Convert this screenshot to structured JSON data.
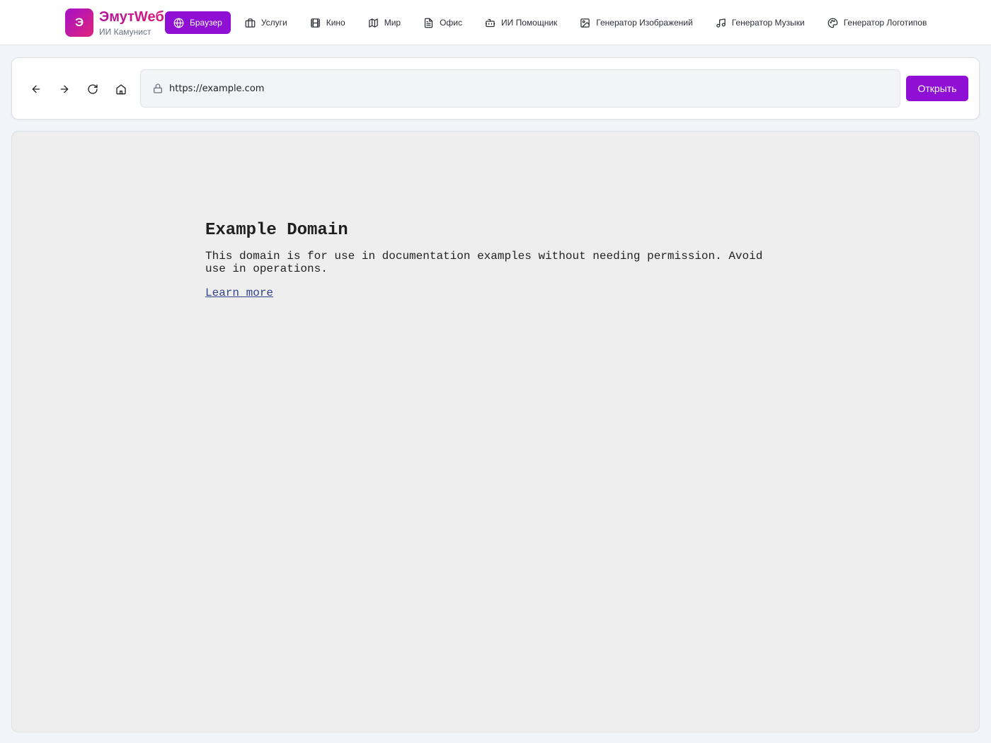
{
  "app": {
    "logo_letter": "Э",
    "name": "ЭмутWeб",
    "subtitle": "ИИ Камунист"
  },
  "nav": {
    "items": [
      {
        "label": "Браузер",
        "icon": "globe-icon",
        "active": true
      },
      {
        "label": "Услуги",
        "icon": "briefcase-icon",
        "active": false
      },
      {
        "label": "Кино",
        "icon": "film-icon",
        "active": false
      },
      {
        "label": "Мир",
        "icon": "map-icon",
        "active": false
      },
      {
        "label": "Офис",
        "icon": "document-icon",
        "active": false
      },
      {
        "label": "ИИ Помощник",
        "icon": "robot-icon",
        "active": false
      },
      {
        "label": "Генератор Изображений",
        "icon": "image-icon",
        "active": false
      },
      {
        "label": "Генератор Музыки",
        "icon": "music-icon",
        "active": false
      },
      {
        "label": "Генератор Логотипов",
        "icon": "palette-icon",
        "active": false
      }
    ]
  },
  "browser": {
    "url": "https://example.com",
    "open_label": "Открыть",
    "buttons": [
      "back-icon",
      "forward-icon",
      "reload-icon",
      "home-icon"
    ]
  },
  "page": {
    "title": "Example Domain",
    "text": "This domain is for use in documentation examples without needing permission. Avoid use in operations.",
    "link": "Learn more"
  },
  "colors": {
    "accent": "#8f0fd4",
    "brand_gradient_start": "#a511c9",
    "brand_gradient_end": "#e0237a",
    "link": "#334488"
  }
}
